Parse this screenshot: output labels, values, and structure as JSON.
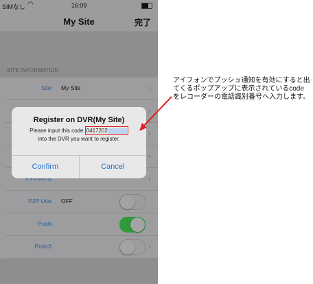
{
  "status": {
    "carrier": "SIMなし",
    "time": "16:09"
  },
  "nav": {
    "title": "My Site",
    "done": "完了"
  },
  "section": "SITE INFORMATION",
  "rows": [
    {
      "label": "Site:",
      "value": "My Site"
    },
    {
      "label": "",
      "value": ""
    },
    {
      "label": "",
      "value": ""
    },
    {
      "label": "",
      "value": ""
    },
    {
      "label": "Password:",
      "value": ""
    },
    {
      "label": "P2P Use:",
      "value": "OFF",
      "toggle": false
    },
    {
      "label": "Push:",
      "value": "",
      "toggle": true
    },
    {
      "label": "Push2:",
      "value": "",
      "toggle": false
    }
  ],
  "dialog": {
    "title": "Register on DVR(My Site)",
    "msg1": "Please input this code",
    "code": "0417202",
    "msg2": "into the DVR you want to register.",
    "confirm": "Confirm",
    "cancel": "Cancel"
  },
  "annotation": "アイフォンでプッシュ通知を有効にすると出てくるポップアップに表示されているcodeをレコーダーの電話識別番号へ入力します。",
  "colors": {
    "accent": "#1f6fc7",
    "highlight": "#dd2222",
    "toggle_on": "#2f9a3c"
  }
}
